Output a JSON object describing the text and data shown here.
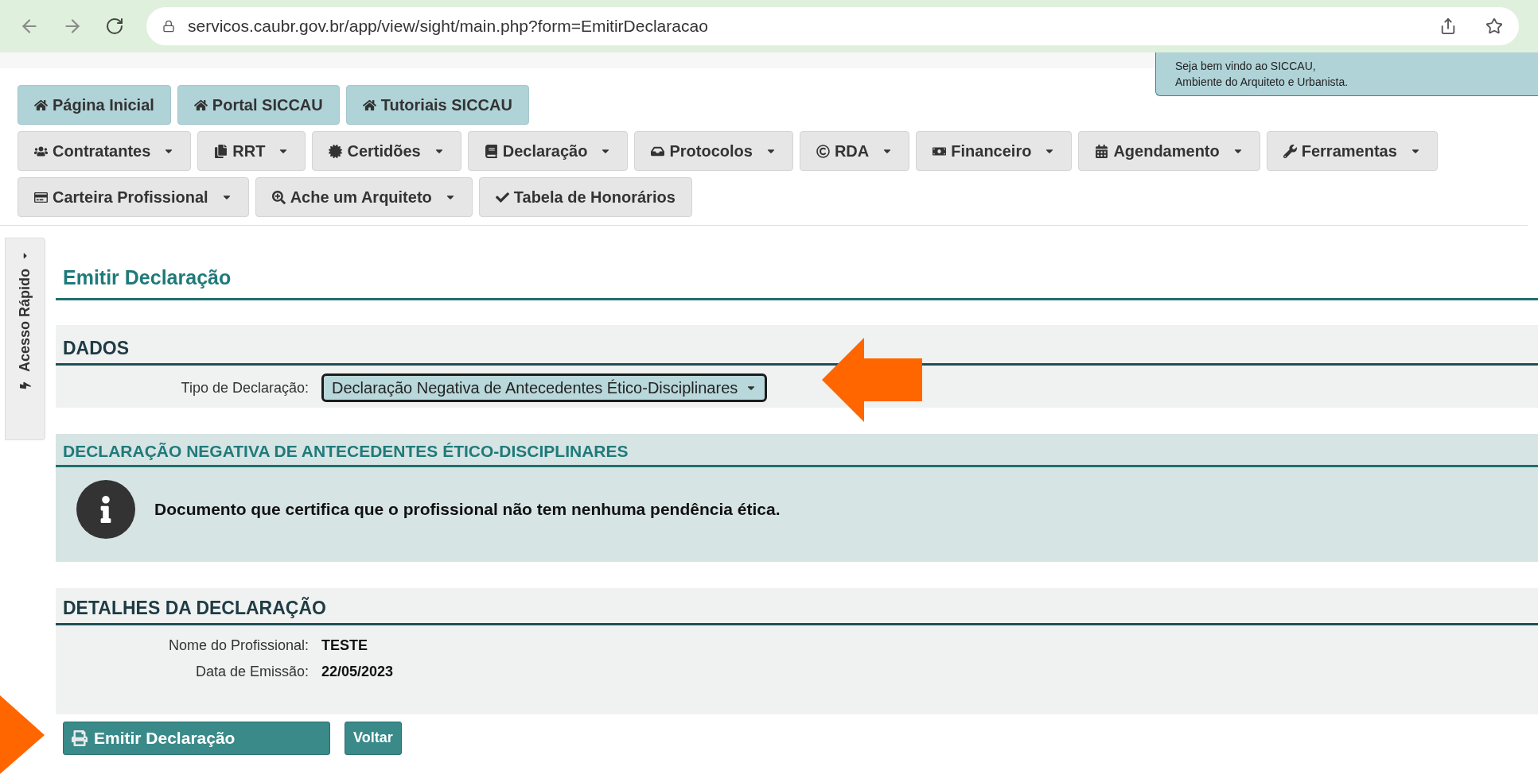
{
  "browser": {
    "url": "servicos.caubr.gov.br/app/view/sight/main.php?form=EmitirDeclaracao"
  },
  "welcome": {
    "lines": [
      "Seja bem vindo ao SICCAU,",
      "Ambiente do Arquiteto e Urbanista."
    ]
  },
  "nav_rows": [
    [
      {
        "label": "Página Inicial",
        "kind": "shortcut",
        "dropdown": false
      },
      {
        "label": "Portal SICCAU",
        "kind": "shortcut",
        "dropdown": false
      },
      {
        "label": "Tutoriais SICCAU",
        "kind": "shortcut",
        "dropdown": false
      }
    ],
    [
      {
        "label": "Contratantes",
        "kind": "menu",
        "dropdown": true
      },
      {
        "label": "RRT",
        "kind": "menu",
        "dropdown": true
      },
      {
        "label": "Certidões",
        "kind": "menu",
        "dropdown": true
      },
      {
        "label": "Declaração",
        "kind": "menu",
        "dropdown": true
      },
      {
        "label": "Protocolos",
        "kind": "menu",
        "dropdown": true
      },
      {
        "label": "RDA",
        "kind": "menu",
        "dropdown": true
      },
      {
        "label": "Financeiro",
        "kind": "menu",
        "dropdown": true
      },
      {
        "label": "Agendamento",
        "kind": "menu",
        "dropdown": true
      },
      {
        "label": "Ferramentas",
        "kind": "menu",
        "dropdown": true
      }
    ],
    [
      {
        "label": "Carteira Profissional",
        "kind": "menu",
        "dropdown": true
      },
      {
        "label": "Ache um Arquiteto",
        "kind": "menu",
        "dropdown": true
      },
      {
        "label": "Tabela de Honorários",
        "kind": "menu",
        "dropdown": false
      }
    ]
  ],
  "sidebar": {
    "label": "Acesso Rápido",
    "expanded": false
  },
  "page_title": "Emitir Declaração",
  "dados": {
    "title": "DADOS",
    "field": {
      "label": "Tipo de Declaração:",
      "value": "Declaração Negativa de Antecedentes Ético-Disciplinares"
    }
  },
  "info": {
    "title": "DECLARAÇÃO NEGATIVA DE ANTECEDENTES ÉTICO-DISCIPLINARES",
    "message": "Documento que certifica que o profissional não tem nenhuma pendência ética."
  },
  "details": {
    "title": "DETALHES DA DECLARAÇÃO",
    "fields": [
      {
        "label": "Nome do Profissional:",
        "value": "TESTE"
      },
      {
        "label": "Data de Emissão:",
        "value": "22/05/2023"
      }
    ]
  },
  "actions": [
    {
      "label": "Emitir Declaração",
      "kind": "primary"
    },
    {
      "label": "Voltar",
      "kind": "secondary"
    }
  ]
}
